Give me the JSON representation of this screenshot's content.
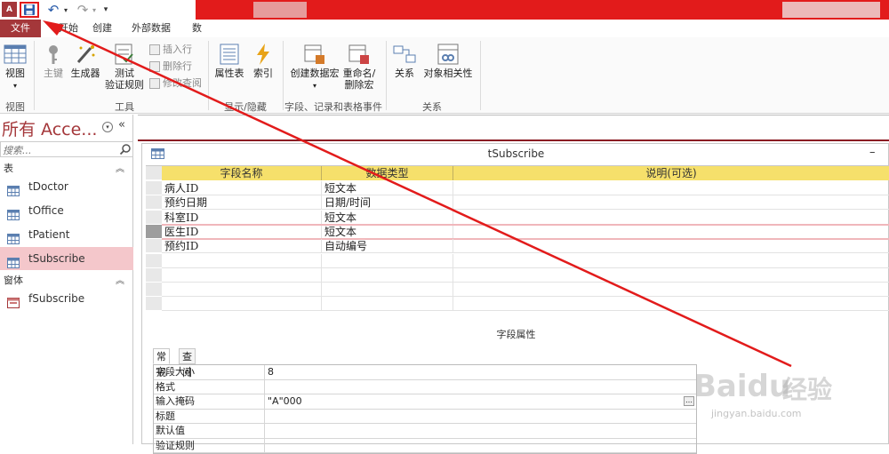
{
  "qat": {
    "logo_text": "A",
    "save_icon": "save-icon",
    "undo_icon": "undo-icon",
    "redo_icon": "redo-icon"
  },
  "tabs": {
    "file": "文件",
    "home": "开始",
    "create": "创建",
    "external": "外部数据",
    "db": "数"
  },
  "ribbon": {
    "view": "视图",
    "view_group": "视图",
    "primary_key": "主键",
    "builder": "生成器",
    "test_rules_line1": "测试",
    "test_rules_line2": "验证规则",
    "insert_row": "插入行",
    "delete_row": "删除行",
    "modify_lookup": "修改查阅",
    "tools_group": "工具",
    "property_sheet": "属性表",
    "indexes": "索引",
    "show_hide_group": "显示/隐藏",
    "create_macro": "创建数据宏",
    "rename_macro_line1": "重命名/",
    "rename_macro_line2": "删除宏",
    "events_group": "字段、记录和表格事件",
    "relationships": "关系",
    "dependencies": "对象相关性",
    "relations_group": "关系"
  },
  "nav": {
    "title": "所有 Acce...",
    "search_placeholder": "搜索...",
    "section_tables": "表",
    "section_forms": "窗体",
    "tables": [
      "tDoctor",
      "tOffice",
      "tPatient",
      "tSubscribe"
    ],
    "forms": [
      "fSubscribe"
    ],
    "active_table": "tSubscribe"
  },
  "window": {
    "title": "tSubscribe",
    "min_label": "–"
  },
  "grid": {
    "headers": [
      "字段名称",
      "数据类型",
      "说明(可选)"
    ],
    "rows": [
      {
        "name": "病人ID",
        "type": "短文本",
        "desc": ""
      },
      {
        "name": "预约日期",
        "type": "日期/时间",
        "desc": ""
      },
      {
        "name": "科室ID",
        "type": "短文本",
        "desc": ""
      },
      {
        "name": "医生ID",
        "type": "短文本",
        "desc": ""
      },
      {
        "name": "预约ID",
        "type": "自动编号",
        "desc": ""
      },
      {
        "name": "",
        "type": "",
        "desc": ""
      },
      {
        "name": "",
        "type": "",
        "desc": ""
      },
      {
        "name": "",
        "type": "",
        "desc": ""
      },
      {
        "name": "",
        "type": "",
        "desc": ""
      }
    ],
    "active_row": 3
  },
  "field_properties": {
    "label": "字段属性",
    "tab_general": "常规",
    "tab_lookup": "查阅",
    "rows": [
      {
        "key": "字段大小",
        "value": "8"
      },
      {
        "key": "格式",
        "value": ""
      },
      {
        "key": "输入掩码",
        "value": "\"A\"000"
      },
      {
        "key": "标题",
        "value": ""
      },
      {
        "key": "默认值",
        "value": ""
      },
      {
        "key": "验证规则",
        "value": ""
      }
    ],
    "ellipsis_label": "…"
  },
  "watermark": {
    "brand": "Bai",
    "brand2": "du",
    "cn": "经验",
    "url": "jingyan.baidu.com"
  },
  "colors": {
    "access_red": "#a4373a",
    "annotation_red": "#e21b1b",
    "header_yellow": "#f6e06b",
    "active_pink": "#f4c7cb"
  }
}
